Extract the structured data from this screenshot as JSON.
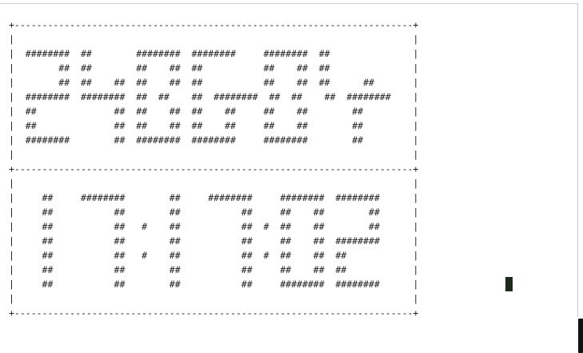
{
  "terminal": {
    "lines": [
      "+------------------------------------------------------------------------+",
      "|                                                                        |",
      "|  ########  ##        ########  ########     ########  ##               |",
      "|        ##  ##        ##    ##  ##           ##    ##  ##               |",
      "|        ##  ##    ##  ##    ##  ##           ##    ##  ##      ##       |",
      "|  ########  ########  ##  ##    ##  ########  ##  ##    ##  ########    |",
      "|  ##              ##  ##    ##  ##    ##     ##    ##        ##         |",
      "|  ##              ##  ##    ##  ##    ##     ##    ##        ##         |",
      "|  ########        ##  ########  ########     ########        ##         |",
      "|                                                                        |",
      "+------------------------------------------------------------------------+",
      "|                                                                        |",
      "|     ##     ########        ##     ########     ########  ########      |",
      "|     ##           ##        ##           ##     ##    ##        ##      |",
      "|     ##           ##   #    ##           ##  #  ##    ##        ##      |",
      "|     ##           ##        ##           ##     ##    ##  ########      |",
      "|     ##           ##   #    ##           ##  #  ##    ##  ##            |",
      "|     ##           ##        ##           ##     ##    ##  ##            |",
      "|     ##           ##        ##           ##     ########  ########      |",
      "|                                                                        |",
      "+------------------------------------------------------------------------+"
    ]
  }
}
